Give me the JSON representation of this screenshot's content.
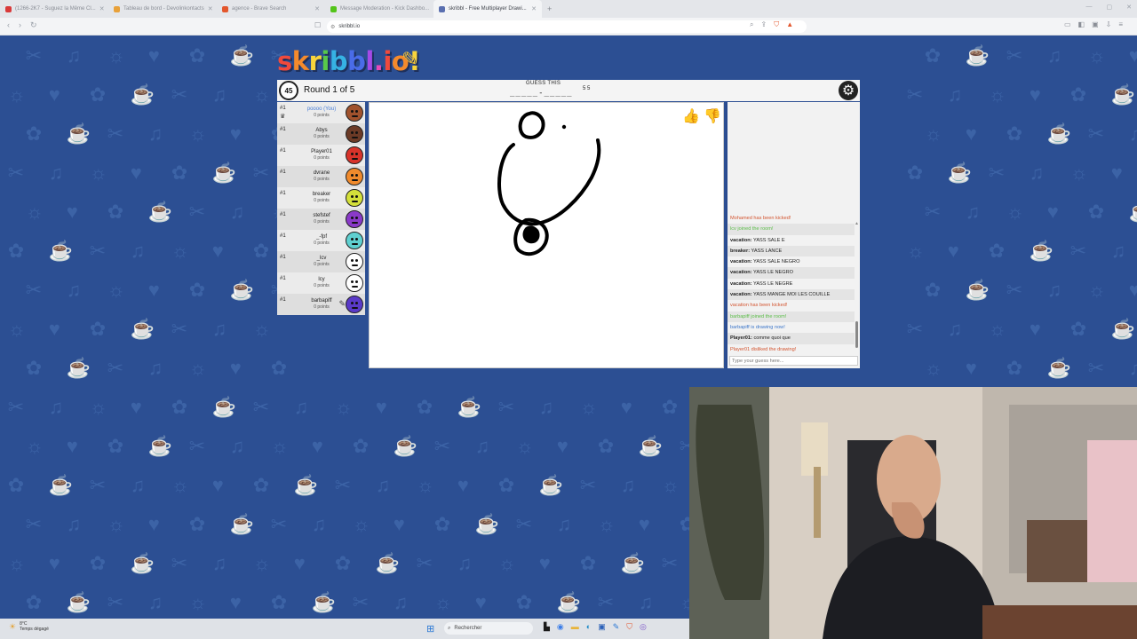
{
  "browser": {
    "tabs": [
      {
        "title": "(1266-2K7 - Suguez la Même Cl...",
        "color": "#d93a3a",
        "active": false
      },
      {
        "title": "Tableau de bord - Devolinkontacts",
        "color": "#e8a13a",
        "active": false
      },
      {
        "title": "agence - Brave Search",
        "color": "#e3572d",
        "active": false
      },
      {
        "title": "Message Moderation - Kick Dashbo...",
        "color": "#53c41a",
        "active": false
      },
      {
        "title": "skribbl - Free Multiplayer Drawi...",
        "color": "#5a6fb0",
        "active": true
      }
    ],
    "new_tab": "+",
    "url": "skribbl.io"
  },
  "game": {
    "logo_letters": [
      "s",
      "k",
      "r",
      "i",
      "b",
      "b",
      "l",
      ".",
      "i",
      "o",
      "!"
    ],
    "logo_colors": [
      "#f04a3c",
      "#f48a2c",
      "#f8d43c",
      "#58c84a",
      "#36b2e4",
      "#4a6ce8",
      "#a44ae8",
      "#e84ab8",
      "#f04a3c",
      "#f48a2c",
      "#f8d43c"
    ],
    "timer": "45",
    "round": "Round 1 of 5",
    "guess_label": "GUESS THIS",
    "guess_word": "_____-_____",
    "guess_lengths": "5 5",
    "players": [
      {
        "rank": "#1",
        "name": "poooo (You)",
        "points": "0 points",
        "color": "#a0522d",
        "you": true,
        "crown": true
      },
      {
        "rank": "#1",
        "name": "Abys",
        "points": "0 points",
        "color": "#6b3a26",
        "you": false,
        "crown": false
      },
      {
        "rank": "#1",
        "name": "Player01",
        "points": "0 points",
        "color": "#d8332a",
        "you": false,
        "crown": false
      },
      {
        "rank": "#1",
        "name": "dvrane",
        "points": "0 points",
        "color": "#f08a2c",
        "you": false,
        "crown": false
      },
      {
        "rank": "#1",
        "name": "breaker",
        "points": "0 points",
        "color": "#d4e03a",
        "you": false,
        "crown": false
      },
      {
        "rank": "#1",
        "name": "stefstef",
        "points": "0 points",
        "color": "#8a3ac8",
        "you": false,
        "crown": false
      },
      {
        "rank": "#1",
        "name": "_-fpf",
        "points": "0 points",
        "color": "#5fd0d0",
        "you": false,
        "crown": false
      },
      {
        "rank": "#1",
        "name": "_lcv",
        "points": "0 points",
        "color": "#ffffff",
        "you": false,
        "crown": false
      },
      {
        "rank": "#1",
        "name": "lcy",
        "points": "0 points",
        "color": "#ffffff",
        "you": false,
        "crown": false
      },
      {
        "rank": "#1",
        "name": "barbapiff",
        "points": "0 points",
        "color": "#5a3ac8",
        "you": false,
        "crown": false,
        "drawing": true
      }
    ],
    "chat": [
      {
        "who": "",
        "text": "Mohamed has been kicked!",
        "style": "red"
      },
      {
        "who": "",
        "text": "lcv joined the room!",
        "style": "green"
      },
      {
        "who": "vacation:",
        "text": "YASS SALE E",
        "style": "normal"
      },
      {
        "who": "breaker:",
        "text": "YASS LANCE",
        "style": "normal"
      },
      {
        "who": "vacation:",
        "text": "YASS SALE NEGRO",
        "style": "normal"
      },
      {
        "who": "vacation:",
        "text": "YASS LE NEGRO",
        "style": "normal"
      },
      {
        "who": "vacation:",
        "text": "YASS LE NEGRE",
        "style": "normal"
      },
      {
        "who": "vacation:",
        "text": "YASS MANGE MOI LES COUILLE",
        "style": "normal"
      },
      {
        "who": "",
        "text": "vacation has been kicked!",
        "style": "red"
      },
      {
        "who": "",
        "text": "barbapiff joined the room!",
        "style": "green"
      },
      {
        "who": "",
        "text": "barbapiff is drawing now!",
        "style": "blue"
      },
      {
        "who": "Player01:",
        "text": "comme quoi que",
        "style": "normal"
      },
      {
        "who": "",
        "text": "Player01 disliked the drawing!",
        "style": "red"
      }
    ],
    "chat_placeholder": "Type your guess here..."
  },
  "taskbar": {
    "temp": "8°C",
    "weather": "Temps dégagé",
    "search": "Rechercher"
  },
  "icons": {
    "settings": "gear-icon",
    "like": "thumbs-up-icon",
    "dislike": "thumbs-down-icon",
    "clock": "alarm-clock-icon"
  }
}
